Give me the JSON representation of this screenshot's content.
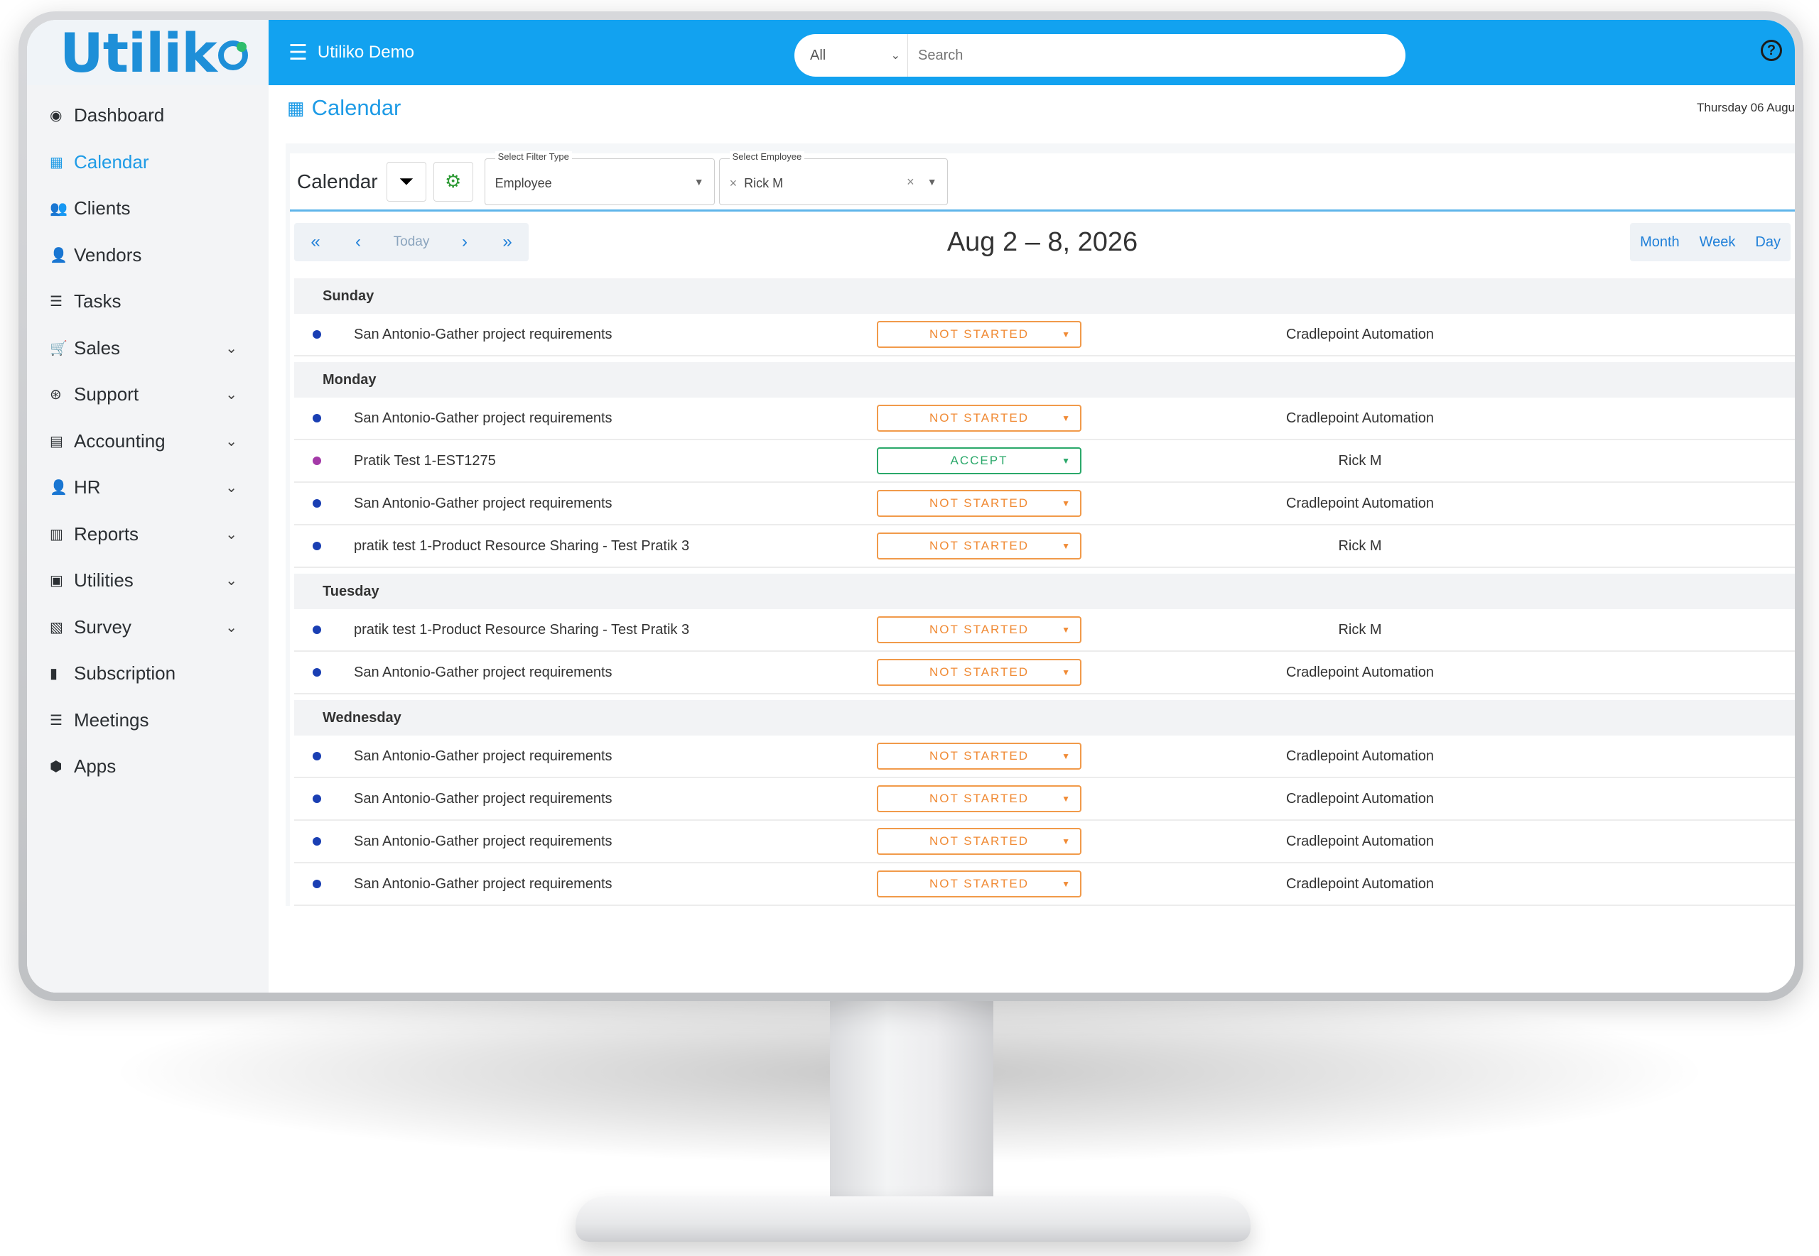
{
  "app": {
    "logo_text": "Utilik",
    "workspace_name": "Utiliko Demo",
    "search_scope": "All",
    "search_placeholder": "Search",
    "help_glyph": "?",
    "accent_color": "#12a2f0"
  },
  "sidebar": {
    "items": [
      {
        "label": "Dashboard",
        "icon": "dashboard-icon",
        "glyph": "◉",
        "expandable": false,
        "active": false
      },
      {
        "label": "Calendar",
        "icon": "calendar-icon",
        "glyph": "▦",
        "expandable": false,
        "active": true
      },
      {
        "label": "Clients",
        "icon": "users-icon",
        "glyph": "👥",
        "expandable": false,
        "active": false
      },
      {
        "label": "Vendors",
        "icon": "user-icon",
        "glyph": "👤",
        "expandable": false,
        "active": false
      },
      {
        "label": "Tasks",
        "icon": "server-icon",
        "glyph": "☰",
        "expandable": false,
        "active": false
      },
      {
        "label": "Sales",
        "icon": "cart-icon",
        "glyph": "🛒",
        "expandable": true,
        "active": false
      },
      {
        "label": "Support",
        "icon": "lifebuoy-icon",
        "glyph": "⊛",
        "expandable": true,
        "active": false
      },
      {
        "label": "Accounting",
        "icon": "calculator-icon",
        "glyph": "▤",
        "expandable": true,
        "active": false
      },
      {
        "label": "HR",
        "icon": "user-icon",
        "glyph": "👤",
        "expandable": true,
        "active": false
      },
      {
        "label": "Reports",
        "icon": "chart-icon",
        "glyph": "▥",
        "expandable": true,
        "active": false
      },
      {
        "label": "Utilities",
        "icon": "gift-icon",
        "glyph": "▣",
        "expandable": true,
        "active": false
      },
      {
        "label": "Survey",
        "icon": "survey-icon",
        "glyph": "▧",
        "expandable": true,
        "active": false
      },
      {
        "label": "Subscription",
        "icon": "receipt-icon",
        "glyph": "▮",
        "expandable": false,
        "active": false
      },
      {
        "label": "Meetings",
        "icon": "server-icon",
        "glyph": "☰",
        "expandable": false,
        "active": false
      },
      {
        "label": "Apps",
        "icon": "cube-icon",
        "glyph": "⬢",
        "expandable": false,
        "active": false
      }
    ]
  },
  "page": {
    "title": "Calendar",
    "date": "Thursday 06 Augu"
  },
  "filters": {
    "label": "Calendar",
    "filter_type_caption": "Select Filter Type",
    "filter_type_value": "Employee",
    "employee_caption": "Select Employee",
    "employee_value": "Rick M",
    "employee_remove": "×",
    "clear_glyph": "×"
  },
  "nav": {
    "today_label": "Today",
    "range_label": "Aug 2 – 8, 2026",
    "views": [
      "Month",
      "Week",
      "Day"
    ]
  },
  "status_colors": {
    "NOT STARTED": "#f08a34",
    "ACCEPT": "#2aa86a"
  },
  "days": [
    {
      "name": "Sunday",
      "events": [
        {
          "title": "San Antonio-Gather project requirements",
          "status": "NOT STARTED",
          "assignee": "Cradlepoint Automation",
          "dot_color": "#1a3fb3"
        }
      ]
    },
    {
      "name": "Monday",
      "events": [
        {
          "title": "San Antonio-Gather project requirements",
          "status": "NOT STARTED",
          "assignee": "Cradlepoint Automation",
          "dot_color": "#1a3fb3"
        },
        {
          "title": "Pratik Test 1-EST1275",
          "status": "ACCEPT",
          "assignee": "Rick M",
          "dot_color": "#a43aa8"
        },
        {
          "title": "San Antonio-Gather project requirements",
          "status": "NOT STARTED",
          "assignee": "Cradlepoint Automation",
          "dot_color": "#1a3fb3"
        },
        {
          "title": "pratik test 1-Product Resource Sharing - Test Pratik 3",
          "status": "NOT STARTED",
          "assignee": "Rick M",
          "dot_color": "#1a3fb3"
        }
      ]
    },
    {
      "name": "Tuesday",
      "events": [
        {
          "title": "pratik test 1-Product Resource Sharing - Test Pratik 3",
          "status": "NOT STARTED",
          "assignee": "Rick M",
          "dot_color": "#1a3fb3"
        },
        {
          "title": "San Antonio-Gather project requirements",
          "status": "NOT STARTED",
          "assignee": "Cradlepoint Automation",
          "dot_color": "#1a3fb3"
        }
      ]
    },
    {
      "name": "Wednesday",
      "events": [
        {
          "title": "San Antonio-Gather project requirements",
          "status": "NOT STARTED",
          "assignee": "Cradlepoint Automation",
          "dot_color": "#1a3fb3"
        },
        {
          "title": "San Antonio-Gather project requirements",
          "status": "NOT STARTED",
          "assignee": "Cradlepoint Automation",
          "dot_color": "#1a3fb3"
        },
        {
          "title": "San Antonio-Gather project requirements",
          "status": "NOT STARTED",
          "assignee": "Cradlepoint Automation",
          "dot_color": "#1a3fb3"
        },
        {
          "title": "San Antonio-Gather project requirements",
          "status": "NOT STARTED",
          "assignee": "Cradlepoint Automation",
          "dot_color": "#1a3fb3"
        }
      ]
    }
  ]
}
